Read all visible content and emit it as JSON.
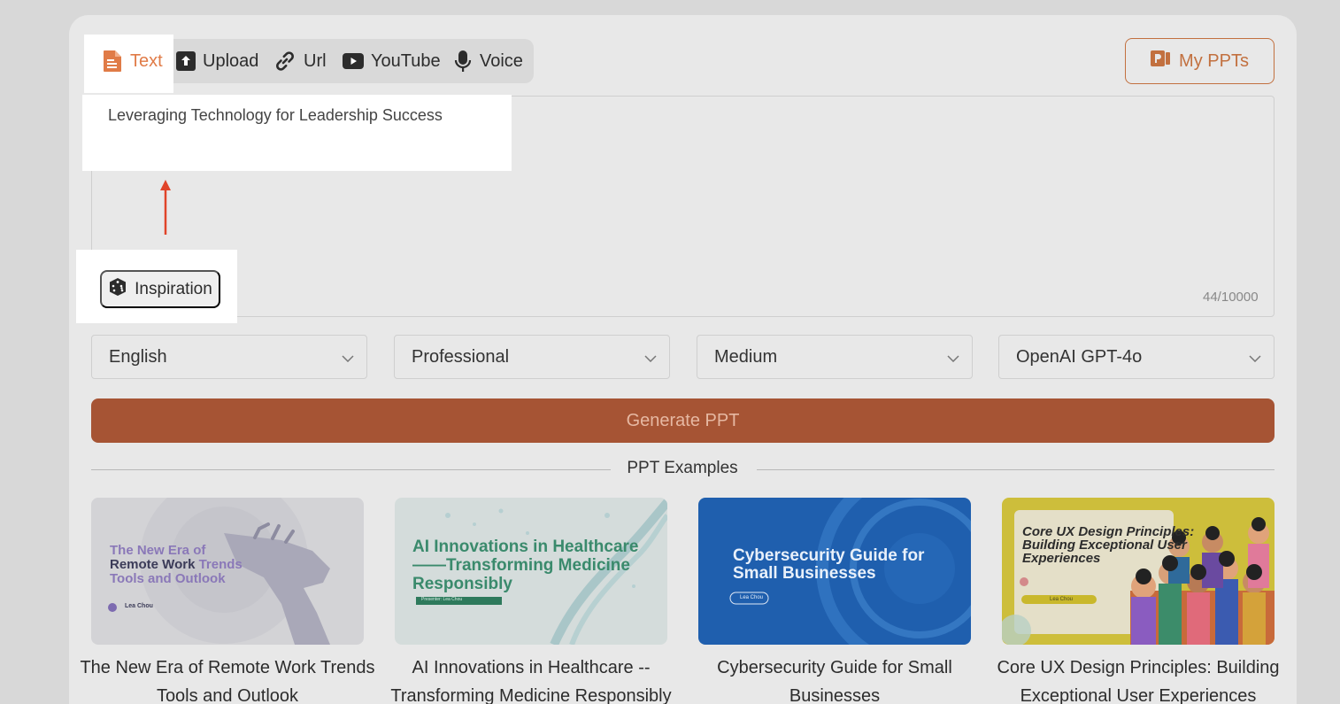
{
  "tabs": [
    {
      "label": "Text",
      "icon": "document-icon",
      "active": true
    },
    {
      "label": "Upload",
      "icon": "upload-icon"
    },
    {
      "label": "Url",
      "icon": "link-icon"
    },
    {
      "label": "YouTube",
      "icon": "youtube-icon"
    },
    {
      "label": "Voice",
      "icon": "microphone-icon"
    }
  ],
  "my_ppts_label": "My PPTs",
  "topic_input": {
    "value": "Leveraging Technology for Leadership Success",
    "counter": "44/10000"
  },
  "inspiration_label": "Inspiration",
  "selects": [
    {
      "value": "English"
    },
    {
      "value": "Professional"
    },
    {
      "value": "Medium"
    },
    {
      "value": "OpenAI GPT-4o"
    }
  ],
  "generate_label": "Generate PPT",
  "examples_title": "PPT Examples",
  "examples": [
    {
      "caption": "The New Era of Remote Work Trends Tools and Outlook",
      "slide_line1": "The New Era of",
      "slide_line2a": "Remote Work",
      "slide_line2b": " Trends",
      "slide_line3": "Tools and Outlook",
      "author": "Lea Chou"
    },
    {
      "caption": "AI Innovations in Healthcare -- Transforming Medicine Responsibly",
      "slide_line1": "AI Innovations in Healthcare",
      "slide_line2": "——Transforming Medicine",
      "slide_line3": "Responsibly",
      "author": "Presenter: Lea Chou"
    },
    {
      "caption": "Cybersecurity Guide for Small Businesses",
      "slide_line1": "Cybersecurity Guide for",
      "slide_line2": "Small Businesses",
      "author": "Lea Chou"
    },
    {
      "caption": "Core UX Design Principles: Building Exceptional User Experiences",
      "slide_line1": "Core UX Design Principles:",
      "slide_line2": " Building Exceptional User",
      "slide_line3": "Experiences",
      "author": "Lea Chou"
    }
  ],
  "colors": {
    "accent": "#c2703f",
    "generate_bg": "#a65434",
    "arrow": "#e0442a"
  }
}
